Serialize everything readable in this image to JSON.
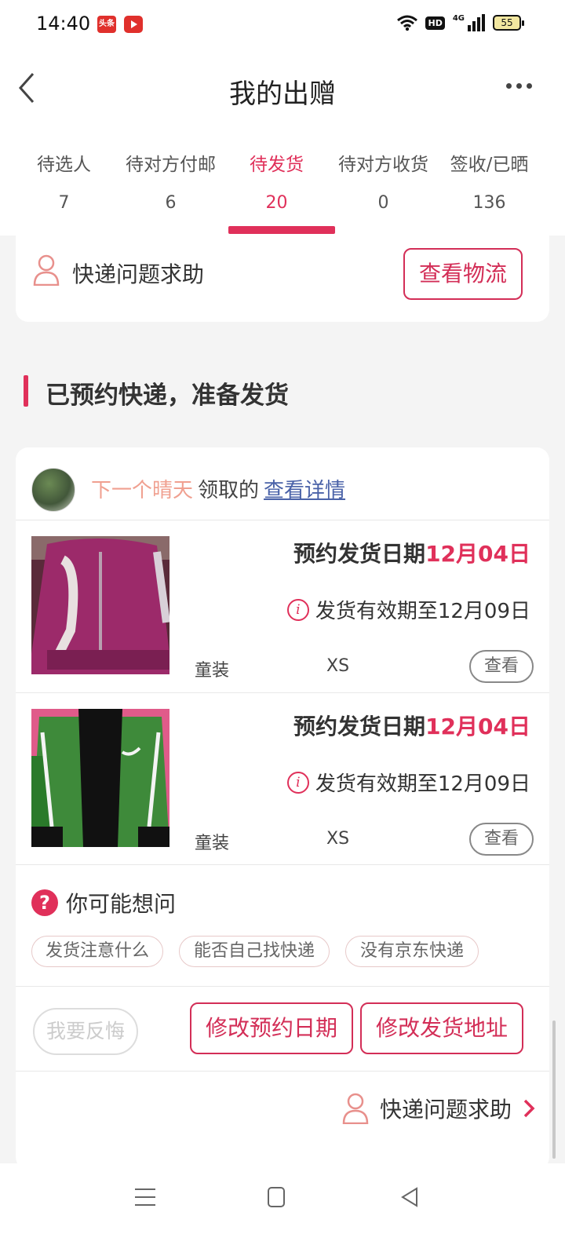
{
  "status_bar": {
    "time": "14:40",
    "badge_text": "头条",
    "network": "4G",
    "hd": "HD",
    "battery": "55"
  },
  "header": {
    "title": "我的出赠"
  },
  "tabs": [
    {
      "label": "待选人",
      "count": "7",
      "active": false
    },
    {
      "label": "待对方付邮",
      "count": "6",
      "active": false
    },
    {
      "label": "待发货",
      "count": "20",
      "active": true
    },
    {
      "label": "待对方收货",
      "count": "0",
      "active": false
    },
    {
      "label": "签收/已晒",
      "count": "136",
      "active": false
    }
  ],
  "top_card": {
    "help_label": "快递问题求助",
    "logistics_button": "查看物流"
  },
  "section": {
    "title": "已预约快递，准备发货"
  },
  "order": {
    "receiver_name": "下一个晴天",
    "receiver_suffix": "领取的",
    "details_link": "查看详情",
    "items": [
      {
        "date_label": "预约发货日期",
        "date_value": "12月04日",
        "valid_text": "发货有效期至12月09日",
        "category": "童装",
        "size": "XS",
        "view_label": "查看",
        "image": "purple-fleece-jacket"
      },
      {
        "date_label": "预约发货日期",
        "date_value": "12月04日",
        "valid_text": "发货有效期至12月09日",
        "category": "童装",
        "size": "XS",
        "view_label": "查看",
        "image": "green-zip-hoodie"
      }
    ],
    "faq": {
      "title": "你可能想问",
      "chips": [
        "发货注意什么",
        "能否自己找快递",
        "没有京东快递"
      ]
    },
    "actions": {
      "regret": "我要反悔",
      "change_date": "修改预约日期",
      "change_address": "修改发货地址"
    },
    "help_label": "快递问题求助"
  },
  "colors": {
    "accent": "#e0305a",
    "receiver": "#f0a090",
    "link": "#4a62a8"
  }
}
